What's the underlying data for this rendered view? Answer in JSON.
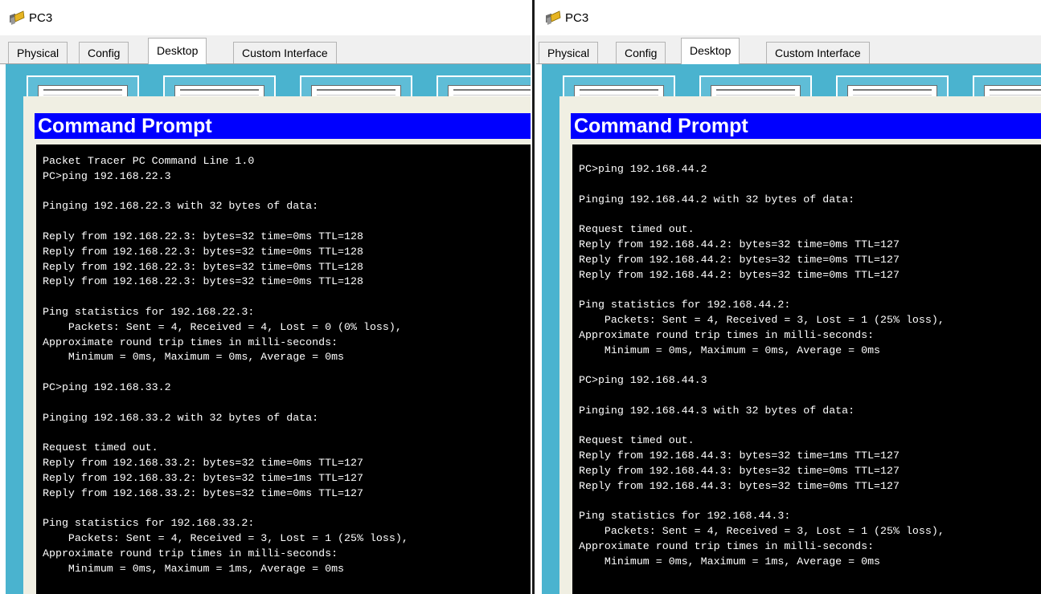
{
  "left": {
    "title": "PC3",
    "tabs": [
      {
        "label": "Physical"
      },
      {
        "label": "Config"
      },
      {
        "label": "Desktop"
      },
      {
        "label": "Custom Interface"
      }
    ],
    "window_title": "Command Prompt",
    "console_lines": [
      "Packet Tracer PC Command Line 1.0",
      "PC>ping 192.168.22.3",
      "",
      "Pinging 192.168.22.3 with 32 bytes of data:",
      "",
      "Reply from 192.168.22.3: bytes=32 time=0ms TTL=128",
      "Reply from 192.168.22.3: bytes=32 time=0ms TTL=128",
      "Reply from 192.168.22.3: bytes=32 time=0ms TTL=128",
      "Reply from 192.168.22.3: bytes=32 time=0ms TTL=128",
      "",
      "Ping statistics for 192.168.22.3:",
      "    Packets: Sent = 4, Received = 4, Lost = 0 (0% loss),",
      "Approximate round trip times in milli-seconds:",
      "    Minimum = 0ms, Maximum = 0ms, Average = 0ms",
      "",
      "PC>ping 192.168.33.2",
      "",
      "Pinging 192.168.33.2 with 32 bytes of data:",
      "",
      "Request timed out.",
      "Reply from 192.168.33.2: bytes=32 time=0ms TTL=127",
      "Reply from 192.168.33.2: bytes=32 time=1ms TTL=127",
      "Reply from 192.168.33.2: bytes=32 time=0ms TTL=127",
      "",
      "Ping statistics for 192.168.33.2:",
      "    Packets: Sent = 4, Received = 3, Lost = 1 (25% loss),",
      "Approximate round trip times in milli-seconds:",
      "    Minimum = 0ms, Maximum = 1ms, Average = 0ms"
    ]
  },
  "right": {
    "title": "PC3",
    "tabs": [
      {
        "label": "Physical"
      },
      {
        "label": "Config"
      },
      {
        "label": "Desktop"
      },
      {
        "label": "Custom Interface"
      }
    ],
    "window_title": "Command Prompt",
    "console_lines": [
      "PC>ping 192.168.44.2",
      "",
      "Pinging 192.168.44.2 with 32 bytes of data:",
      "",
      "Request timed out.",
      "Reply from 192.168.44.2: bytes=32 time=0ms TTL=127",
      "Reply from 192.168.44.2: bytes=32 time=0ms TTL=127",
      "Reply from 192.168.44.2: bytes=32 time=0ms TTL=127",
      "",
      "Ping statistics for 192.168.44.2:",
      "    Packets: Sent = 4, Received = 3, Lost = 1 (25% loss),",
      "Approximate round trip times in milli-seconds:",
      "    Minimum = 0ms, Maximum = 0ms, Average = 0ms",
      "",
      "PC>ping 192.168.44.3",
      "",
      "Pinging 192.168.44.3 with 32 bytes of data:",
      "",
      "Request timed out.",
      "Reply from 192.168.44.3: bytes=32 time=1ms TTL=127",
      "Reply from 192.168.44.3: bytes=32 time=0ms TTL=127",
      "Reply from 192.168.44.3: bytes=32 time=0ms TTL=127",
      "",
      "Ping statistics for 192.168.44.3:",
      "    Packets: Sent = 4, Received = 3, Lost = 1 (25% loss),",
      "Approximate round trip times in milli-seconds:",
      "    Minimum = 0ms, Maximum = 1ms, Average = 0ms"
    ]
  }
}
